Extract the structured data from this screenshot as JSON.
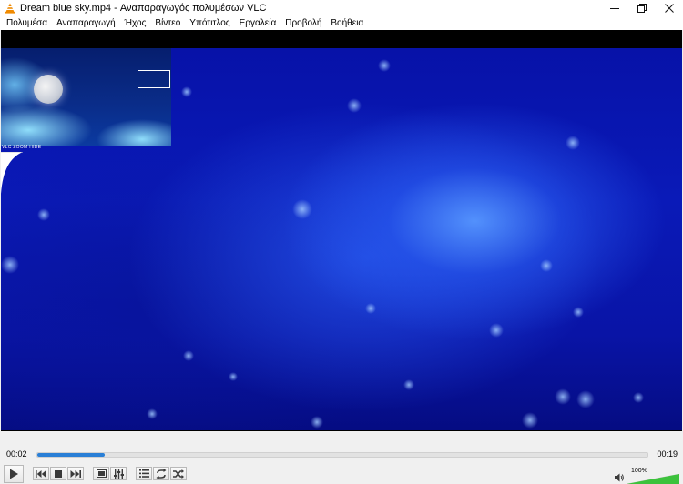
{
  "window": {
    "title": "Dream blue sky.mp4 - Αναπαραγωγός πολυμέσων VLC",
    "controls": [
      "minimize-icon",
      "restore-icon",
      "close-icon"
    ]
  },
  "menu": [
    {
      "label": "Πολυμέσα"
    },
    {
      "label": "Αναπαραγωγή"
    },
    {
      "label": "Ήχος"
    },
    {
      "label": "Βίντεο"
    },
    {
      "label": "Υπότιτλος"
    },
    {
      "label": "Εργαλεία"
    },
    {
      "label": "Προβολή"
    },
    {
      "label": "Βοήθεια"
    }
  ],
  "zoom": {
    "label": "VLC ZOOM HIDE"
  },
  "playback": {
    "elapsed": "00:02",
    "total": "00:19",
    "progress": 0.11
  },
  "controls": {
    "buttons": [
      "play-icon",
      "prev-icon",
      "stop-icon",
      "next-icon",
      "fullscreen-icon",
      "extended-settings-icon",
      "playlist-icon",
      "loop-icon",
      "shuffle-icon"
    ]
  },
  "volume": {
    "label": "100%",
    "level": 1.0
  },
  "colors": {
    "accent": "#2a7fd6",
    "volume": "#3cc23c"
  }
}
